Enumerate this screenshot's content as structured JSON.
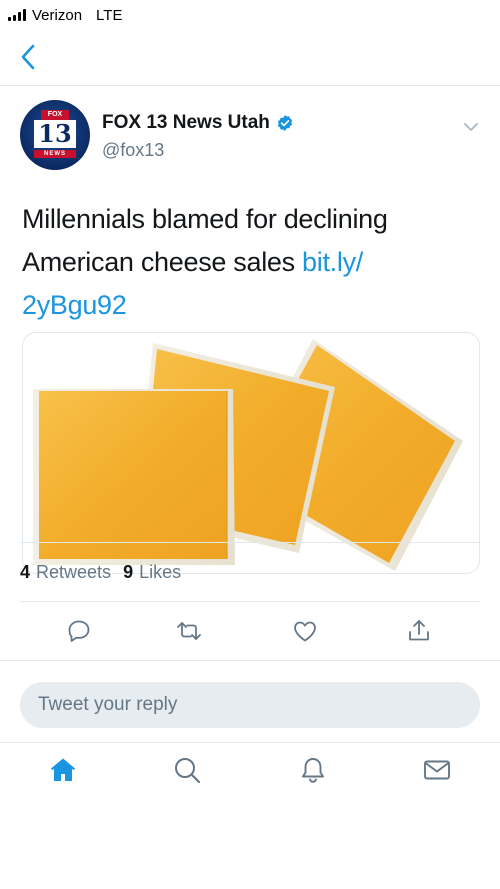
{
  "status_bar": {
    "carrier": "Verizon",
    "network": "LTE"
  },
  "nav": {
    "back_icon": "chevron-left-icon"
  },
  "tweet": {
    "display_name": "FOX 13 News Utah",
    "handle": "@fox13",
    "avatar": {
      "top_label": "FOX",
      "number": "13",
      "bottom_label": "NEWS"
    },
    "text": "Millennials blamed for declining American cheese sales ",
    "link": "bit.ly/\n2yBgu92",
    "link_line1": "bit.ly/",
    "link_line2": "2yBgu92",
    "media": {
      "description_icon": "cheese-slices-image"
    }
  },
  "stats": {
    "retweets_count": "4",
    "retweets_label": "Retweets",
    "likes_count": "9",
    "likes_label": "Likes"
  },
  "actions": [
    "reply-icon",
    "retweet-icon",
    "like-icon",
    "share-icon"
  ],
  "reply": {
    "placeholder": "Tweet your reply"
  },
  "tabs": [
    "home-icon",
    "search-icon",
    "notifications-icon",
    "messages-icon"
  ],
  "colors": {
    "accent": "#1b95e0",
    "muted": "#657786",
    "reply_bg": "#e6ecf0",
    "cheese": "#f5b53a"
  }
}
